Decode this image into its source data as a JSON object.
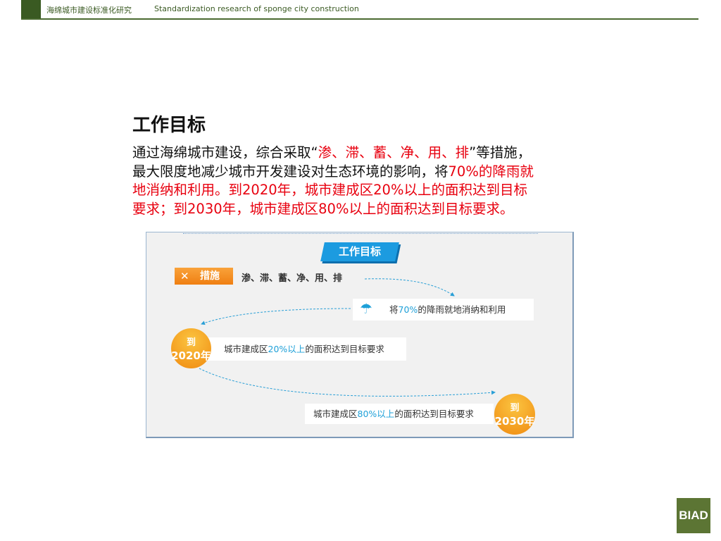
{
  "header": {
    "cn_title": "海绵城市建设标准化研究",
    "en_title": "Standardization research of sponge city construction"
  },
  "title": "工作目标",
  "paragraph": {
    "l1a": "通过海绵城市建设，综合采取“",
    "l1b": "渗、滞、蓄、净、用、排",
    "l1c": "”等措施，",
    "l2a": "最大限度地减少城市开发建设对生态环境的影响，将",
    "l2b": "70%的降雨就",
    "l3": "地消纳和利用。到2020年，城市建成区20%以上的面积达到目标",
    "l4": "要求；到2030年，城市建成区80%以上的面积达到目标要求。"
  },
  "figure": {
    "banner": "工作目标",
    "tag": "措施",
    "tag_icon": "✕",
    "measures": "渗、滞、蓄、净、用、排",
    "rain": {
      "a": "将",
      "b": "70%",
      "c": "的降雨就地消纳和利用"
    },
    "goal2020": {
      "circle_top": "到",
      "circle_year": "2020年",
      "a": "城市建成区",
      "b": "20%以上",
      "c": "的面积达到目标要求"
    },
    "goal2030": {
      "circle_top": "到",
      "circle_year": "2030年",
      "a": "城市建成区",
      "b": "80%以上",
      "c": "的面积达到目标要求"
    }
  },
  "logo": "BIAD"
}
